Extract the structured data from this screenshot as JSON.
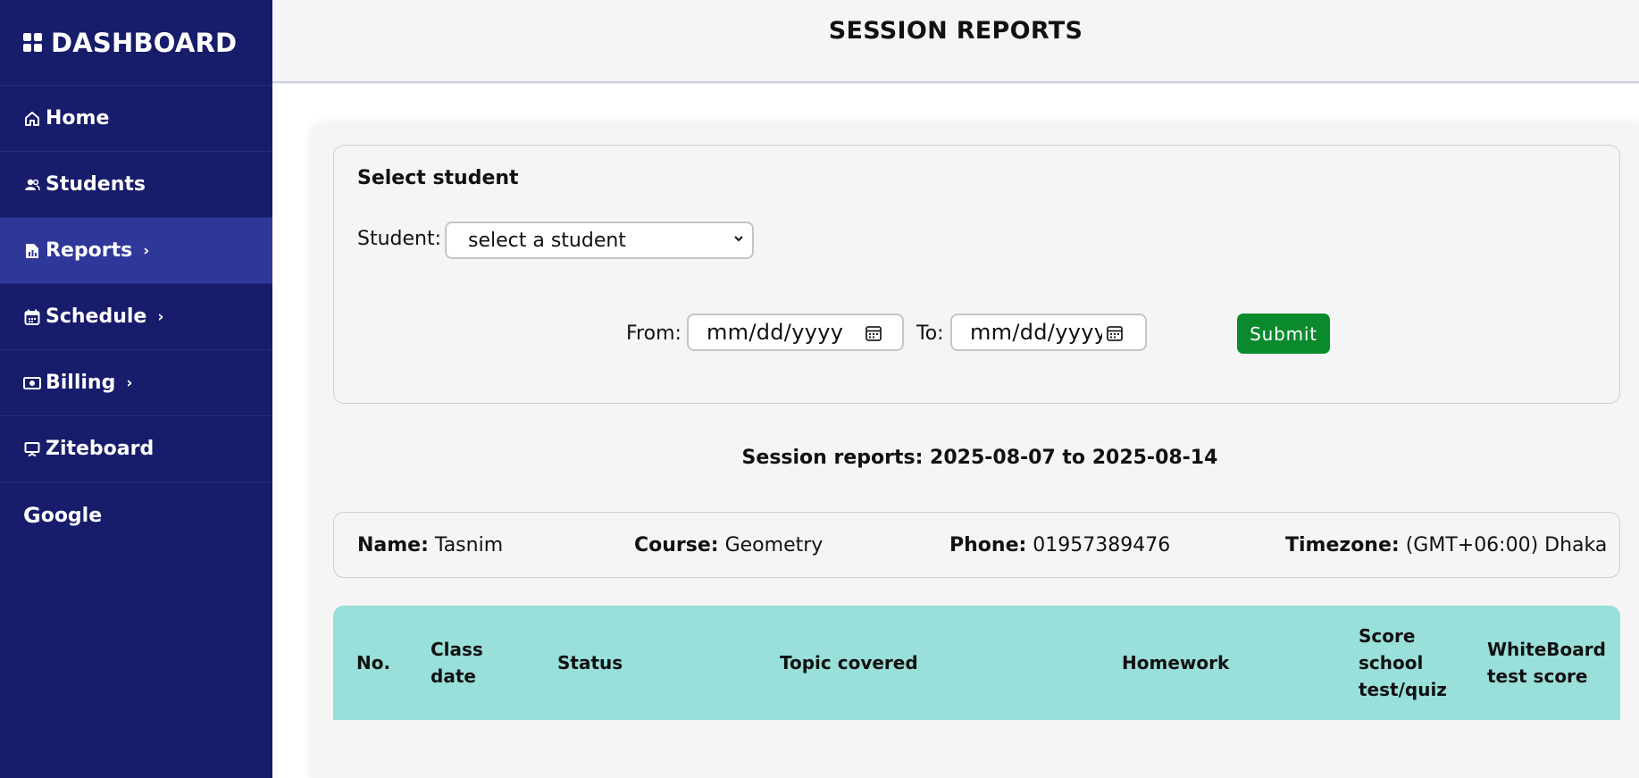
{
  "sidebar": {
    "brand": "DASHBOARD",
    "items": [
      {
        "label": "Home",
        "icon": "home-icon"
      },
      {
        "label": "Students",
        "icon": "users-icon"
      },
      {
        "label": "Reports",
        "icon": "report-icon",
        "chevron": "›"
      },
      {
        "label": "Schedule",
        "icon": "calendar-icon",
        "chevron": "›"
      },
      {
        "label": "Billing",
        "icon": "money-icon",
        "chevron": "›"
      },
      {
        "label": "Ziteboard",
        "icon": "board-icon"
      },
      {
        "label": "oogle",
        "prefix": "G"
      }
    ]
  },
  "header": {
    "title": "SESSION REPORTS"
  },
  "filter": {
    "title": "Select student",
    "student_label": "Student:",
    "student_selected": "select a student",
    "from_label": "From:",
    "from_placeholder": "mm/dd/yyyy",
    "to_label": "To:",
    "to_placeholder": "mm/dd/yyyy",
    "submit_label": "Submit"
  },
  "report": {
    "range_title": "Session reports: 2025-08-07 to 2025-08-14",
    "name_label": "Name:",
    "name_value": "Tasnim",
    "course_label": "Course:",
    "course_value": "Geometry",
    "phone_label": "Phone:",
    "phone_value": "01957389476",
    "timezone_label": "Timezone:",
    "timezone_value": "(GMT+06:00) Dhaka"
  },
  "table": {
    "headers": [
      "No.",
      "Class date",
      "Status",
      "Topic covered",
      "Homework",
      "Score school test/quiz",
      "WhiteBoard test score"
    ]
  },
  "colors": {
    "sidebar_bg": "#171c6b",
    "sidebar_active": "#2f3799",
    "submit_bg": "#0a8a2d",
    "table_head_bg": "#99dfda"
  }
}
